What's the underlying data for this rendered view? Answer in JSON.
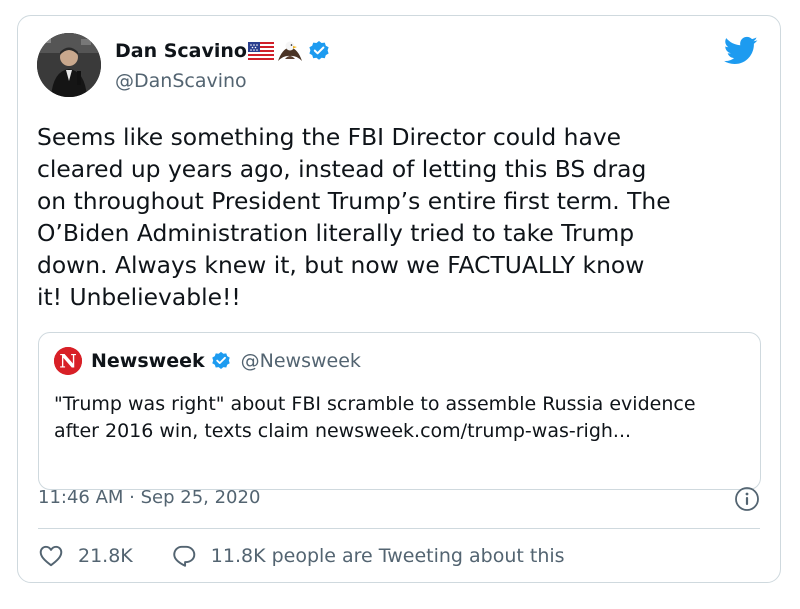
{
  "author": {
    "display_name": "Dan Scavino",
    "handle": "@DanScavino",
    "verified": true,
    "name_emoji": [
      "us-flag-icon",
      "eagle-icon"
    ]
  },
  "tweet": {
    "text": "Seems like something the FBI Director could have\ncleared up years ago, instead of letting this BS drag\non throughout President Trump’s entire first term. The\nO’Biden Administration literally tried to take Trump\ndown. Always knew it, but now we FACTUALLY know\nit! Unbelievable!!"
  },
  "quoted_tweet": {
    "display_name": "Newsweek",
    "handle": "@Newsweek",
    "verified": true,
    "logo_letter": "N",
    "text": "\"Trump was right\" about FBI scramble to assemble Russia evidence after 2016 win, texts claim newsweek.com/trump-was-righ..."
  },
  "timestamp": "11:46 AM · Sep 25, 2020",
  "stats": {
    "likes": "21.8K",
    "tweeting": "11.8K people are Tweeting about this"
  },
  "colors": {
    "twitter_blue": "#1d9bf0",
    "text_primary": "#0f1419",
    "text_secondary": "#536471",
    "border": "#cfd9de",
    "newsweek_red": "#d82027"
  }
}
